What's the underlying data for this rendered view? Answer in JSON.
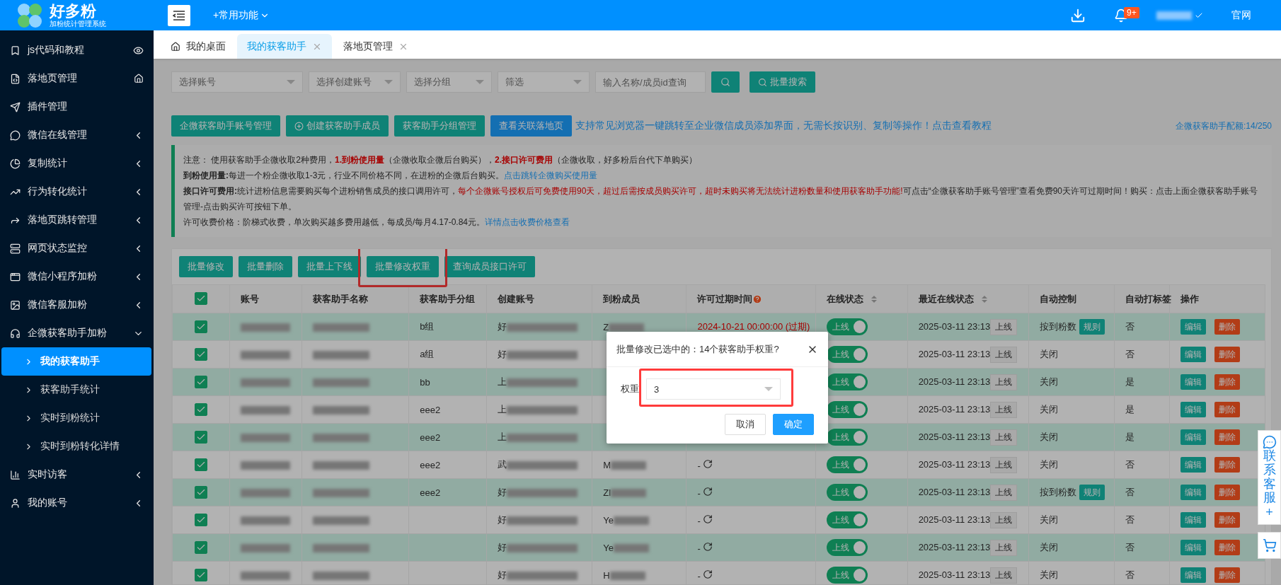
{
  "header": {
    "logo_title": "好多粉",
    "logo_subtitle": "加粉统计管理系统",
    "quick_menu": "+常用功能",
    "notification_badge": "9+",
    "site_link": "官网"
  },
  "sidebar": {
    "items": [
      {
        "label": "js代码和教程"
      },
      {
        "label": "落地页管理"
      },
      {
        "label": "插件管理"
      },
      {
        "label": "微信在线管理",
        "expanded": false
      },
      {
        "label": "复制统计",
        "expanded": false
      },
      {
        "label": "行为转化统计",
        "expanded": false
      },
      {
        "label": "落地页跳转管理",
        "expanded": false
      },
      {
        "label": "网页状态监控",
        "expanded": false
      },
      {
        "label": "微信小程序加粉",
        "expanded": false
      },
      {
        "label": "微信客服加粉",
        "expanded": false
      },
      {
        "label": "企微获客助手加粉",
        "expanded": true,
        "children": [
          {
            "label": "我的获客助手",
            "selected": true
          },
          {
            "label": "获客助手统计",
            "selected": false
          },
          {
            "label": "实时到粉统计",
            "selected": false
          },
          {
            "label": "实时到粉转化详情",
            "selected": false
          }
        ]
      },
      {
        "label": "实时访客",
        "expanded": false
      },
      {
        "label": "我的账号",
        "expanded": false
      }
    ]
  },
  "tabs": [
    {
      "label": "我的桌面",
      "selected": false,
      "closable": false
    },
    {
      "label": "我的获客助手",
      "selected": true,
      "closable": true
    },
    {
      "label": "落地页管理",
      "selected": false,
      "closable": true
    }
  ],
  "filters": {
    "selects": [
      "选择账号",
      "选择创建账号",
      "选择分组",
      "筛选"
    ],
    "search_placeholder": "输入名称/成员id查询",
    "batch_search": "批量搜索"
  },
  "actions": {
    "buttons": [
      "企微获客助手账号管理",
      "创建获客助手成员",
      "获客助手分组管理",
      "查看关联落地页"
    ],
    "tutorial_link": "支持常见浏览器一键跳转至企业微信成员添加界面，无需长按识别、复制等操作！点击查看教程",
    "quota": "企微获客助手配额:14/250"
  },
  "notice": {
    "lines": [
      [
        {
          "text": "注意：  使用获客助手企微收取2种费用，",
          "kind": "plain"
        },
        {
          "text": "1.到粉使用量",
          "kind": "warning"
        },
        {
          "text": "（企微收取企微后台购买），",
          "kind": "plain"
        },
        {
          "text": "2.接口许可费用",
          "kind": "warning"
        },
        {
          "text": "（企微收取，好多粉后台代下单购买）",
          "kind": "plain"
        }
      ],
      [
        {
          "text": "到粉使用量:",
          "kind": "heading"
        },
        {
          "text": "每进一个粉企微收取1-3元，行业不同价格不同，在进粉的企微后台购买。",
          "kind": "plain"
        },
        {
          "text": "点击跳转企微购买使用量",
          "kind": "link"
        }
      ],
      [
        {
          "text": "接口许可费用:",
          "kind": "heading"
        },
        {
          "text": "统计进粉信息需要购买每个进粉销售成员的接口调用许可，",
          "kind": "plain"
        },
        {
          "text": "每个企微账号授权后可免费使用90天，超过后需按成员购买许可，超时未购买将无法统计进粉数量和使用获客助手功能!",
          "kind": "alert"
        },
        {
          "text": "可点击“企微获客助手账号管理”查看免费90天许可过期时间！购买：点击上面企微获客助手账号管理-点击购买许可按钮下单。",
          "kind": "plain"
        }
      ],
      [
        {
          "text": "许可收费价格：阶梯式收费，单次购买越多费用越低，每成员/每月4.17-0.84元。",
          "kind": "plain"
        },
        {
          "text": "详情点击收费价格查看",
          "kind": "link"
        }
      ]
    ]
  },
  "batch_buttons": [
    {
      "label": "批量修改",
      "highlighted": false
    },
    {
      "label": "批量删除",
      "highlighted": false
    },
    {
      "label": "批量上下线",
      "highlighted": false
    },
    {
      "label": "批量修改权重",
      "highlighted": true
    },
    {
      "label": "查询成员接口许可",
      "highlighted": false
    }
  ],
  "table": {
    "all_checked": true,
    "columns": [
      "账号",
      "获客助手名称",
      "获客助手分组",
      "创建账号",
      "到粉成员",
      "许可过期时间",
      "在线状态",
      "最近在线状态",
      "自动控制",
      "自动打标签",
      "操作"
    ],
    "rows": [
      {
        "checked": true,
        "group": "b组",
        "creator": "好",
        "member": "Z",
        "license": {
          "kind": "expired",
          "text": "2024-10-21 00:00:00 (过期)"
        },
        "online": {
          "label": "上线",
          "on": true
        },
        "last_time": "2025-03-11 23:13",
        "last_status": "上线",
        "auto_control": "按到粉数",
        "auto_rule": "规则",
        "auto_tag": "否",
        "actions": [
          "编辑",
          "删除"
        ]
      },
      {
        "checked": true,
        "group": "a组",
        "creator": "好",
        "online": {
          "label": "上线",
          "on": true
        },
        "last_time": "2025-03-11 23:13",
        "last_status": "上线",
        "auto_control": "关闭",
        "auto_tag": "否",
        "actions": [
          "编辑",
          "删除"
        ]
      },
      {
        "checked": true,
        "group": "bb",
        "creator": "上",
        "online": {
          "label": "上线",
          "on": true
        },
        "last_time": "2025-03-11 23:13",
        "last_status": "上线",
        "auto_control": "关闭",
        "auto_tag": "是",
        "actions": [
          "编辑",
          "删除"
        ]
      },
      {
        "checked": true,
        "group": "eee2",
        "creator": "上",
        "online": {
          "label": "上线",
          "on": true
        },
        "last_time": "2025-03-11 23:13",
        "last_status": "上线",
        "auto_control": "关闭",
        "auto_tag": "是",
        "actions": [
          "编辑",
          "删除"
        ]
      },
      {
        "checked": true,
        "group": "eee2",
        "creator": "上",
        "online": {
          "label": "上线",
          "on": true
        },
        "last_time": "2025-03-11 23:13",
        "last_status": "上线",
        "auto_control": "关闭",
        "auto_tag": "是",
        "actions": [
          "编辑",
          "删除"
        ]
      },
      {
        "checked": true,
        "group": "eee2",
        "creator": "武",
        "member": "M",
        "license": {
          "kind": "refresh",
          "text": "-"
        },
        "online": {
          "label": "上线",
          "on": true
        },
        "last_time": "2025-03-11 23:13",
        "last_status": "上线",
        "auto_control": "关闭",
        "auto_tag": "否",
        "actions": [
          "编辑",
          "删除"
        ]
      },
      {
        "checked": true,
        "group": "eee2",
        "creator": "好",
        "member": "Zl",
        "license": {
          "kind": "refresh",
          "text": "-"
        },
        "online": {
          "label": "上线",
          "on": true
        },
        "last_time": "2025-03-11 23:13",
        "last_status": "上线",
        "auto_control": "按到粉数",
        "auto_rule": "规则",
        "auto_tag": "否",
        "actions": [
          "编辑",
          "删除"
        ]
      },
      {
        "checked": true,
        "creator": "好",
        "member": "Ye",
        "license": {
          "kind": "refresh",
          "text": "-"
        },
        "online": {
          "label": "上线",
          "on": true
        },
        "last_time": "2025-03-11 23:13",
        "last_status": "上线",
        "auto_control": "关闭",
        "auto_tag": "否",
        "actions": [
          "编辑",
          "删除"
        ]
      },
      {
        "checked": true,
        "creator": "好",
        "member": "Ye",
        "license": {
          "kind": "refresh",
          "text": "-"
        },
        "online": {
          "label": "上线",
          "on": true
        },
        "last_time": "2025-03-11 23:13",
        "last_status": "上线",
        "auto_control": "关闭",
        "auto_tag": "否",
        "actions": [
          "编辑",
          "删除"
        ]
      },
      {
        "checked": true,
        "creator": "好",
        "member": "H",
        "license": {
          "kind": "refresh",
          "text": "-"
        },
        "online": {
          "label": "上线",
          "on": true
        },
        "last_time": "2025-03-11 23:13",
        "last_status": "上线",
        "auto_control": "关闭",
        "auto_tag": "否",
        "actions": [
          "编辑",
          "删除"
        ]
      }
    ]
  },
  "dialog": {
    "title": "批量修改已选中的：14个获客助手权重?",
    "field_label": "权重",
    "value": "3",
    "buttons": [
      "取消",
      "确定"
    ]
  },
  "side_widget": {
    "label": "联系客服",
    "plus": "+"
  }
}
